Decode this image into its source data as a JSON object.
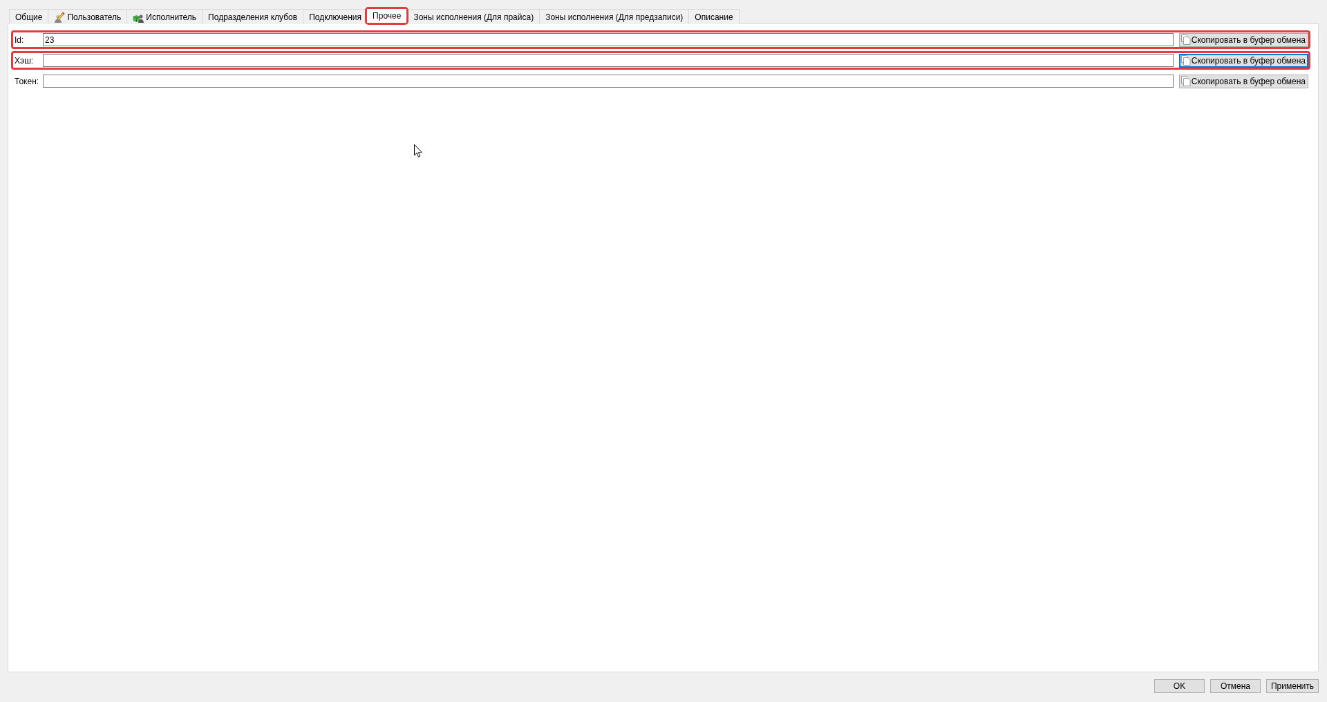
{
  "tabs": [
    {
      "label": "Общие",
      "kind": "plain",
      "selected": false,
      "highlighted": false
    },
    {
      "label": "Пользователь",
      "kind": "icon",
      "selected": false,
      "highlighted": false
    },
    {
      "label": "Исполнитель",
      "kind": "icon",
      "selected": false,
      "highlighted": false
    },
    {
      "label": "Подразделения клубов",
      "kind": "plain",
      "selected": false,
      "highlighted": false
    },
    {
      "label": "Подключения",
      "kind": "plain",
      "selected": false,
      "highlighted": false
    },
    {
      "label": "Прочее",
      "kind": "plain",
      "selected": true,
      "highlighted": true
    },
    {
      "label": "Зоны исполнения (Для прайса)",
      "kind": "plain",
      "selected": false,
      "highlighted": false
    },
    {
      "label": "Зоны исполнения (Для предзаписи)",
      "kind": "plain",
      "selected": false,
      "highlighted": false
    },
    {
      "label": "Описание",
      "kind": "plain",
      "selected": false,
      "highlighted": false
    }
  ],
  "fields": [
    {
      "label": "Id:",
      "value": "23",
      "highlighted": true,
      "copy_button": {
        "label": "Скопировать в буфер обмена",
        "focused": false
      }
    },
    {
      "label": "Хэш:",
      "highlighted": true,
      "copy_button": {
        "label": "Скопировать в буфер обмена",
        "focused": true
      }
    },
    {
      "label": "Токен:",
      "highlighted": false,
      "copy_button": {
        "label": "Скопировать в буфер обмена",
        "focused": false
      }
    }
  ],
  "buttons": [
    {
      "label": "OK"
    },
    {
      "label": "Отмена"
    },
    {
      "label": "Применить"
    }
  ]
}
